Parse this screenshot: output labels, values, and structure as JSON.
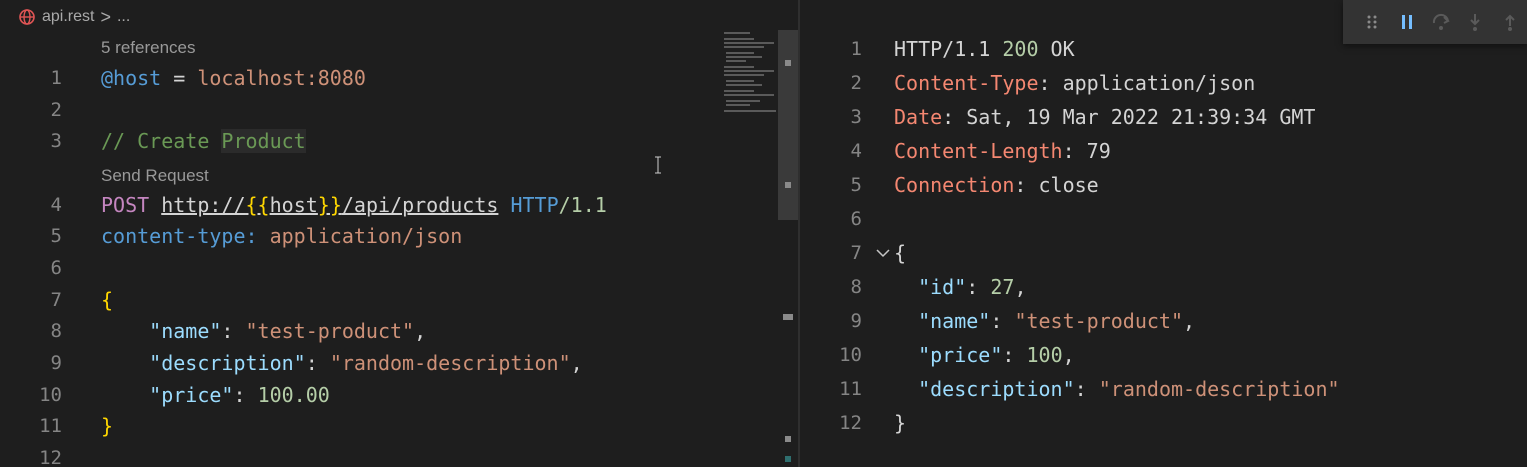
{
  "breadcrumb": {
    "file": "api.rest",
    "separator": ">",
    "more": "..."
  },
  "editor": {
    "references_label": "5 references",
    "send_request_label": "Send Request",
    "line_numbers": [
      "1",
      "2",
      "3",
      "4",
      "5",
      "6",
      "7",
      "8",
      "9",
      "10",
      "11",
      "12"
    ],
    "line1": {
      "var": "@host",
      "eq": " = ",
      "value": "localhost:8080"
    },
    "line3": {
      "comment": "// Create ",
      "comment_word": "Product"
    },
    "line4": {
      "method": "POST",
      "space": " ",
      "url_prefix": "http://",
      "brace_open": "{{",
      "url_var": "host",
      "brace_close": "}}",
      "url_path": "/api/products",
      "proto": "HTTP",
      "version": "/1.1"
    },
    "line5": {
      "header": "content-type:",
      "value": " application/json"
    },
    "line7": "{",
    "line8": {
      "indent": "    ",
      "key": "\"name\"",
      "colon": ": ",
      "value": "\"test-product\"",
      "comma": ","
    },
    "line9": {
      "indent": "    ",
      "key": "\"description\"",
      "colon": ": ",
      "value": "\"random-description\"",
      "comma": ","
    },
    "line10": {
      "indent": "    ",
      "key": "\"price\"",
      "colon": ": ",
      "value": "100.00"
    },
    "line11": "}"
  },
  "response": {
    "line_numbers": [
      "1",
      "2",
      "3",
      "4",
      "5",
      "6",
      "7",
      "8",
      "9",
      "10",
      "11",
      "12"
    ],
    "status": {
      "proto": "HTTP/1.1 ",
      "code": "200",
      "text": " OK"
    },
    "headers": [
      {
        "name": "Content-Type",
        "value": ": application/json"
      },
      {
        "name": "Date",
        "value": ": Sat, 19 Mar 2022 21:39:34 GMT"
      },
      {
        "name": "Content-Length",
        "value": ": 79"
      },
      {
        "name": "Connection",
        "value": ": close"
      }
    ],
    "body_open": "{",
    "body": [
      {
        "indent": "  ",
        "key": "\"id\"",
        "colon": ": ",
        "value": "27",
        "comma": ",",
        "type": "num"
      },
      {
        "indent": "  ",
        "key": "\"name\"",
        "colon": ": ",
        "value": "\"test-product\"",
        "comma": ",",
        "type": "str"
      },
      {
        "indent": "  ",
        "key": "\"price\"",
        "colon": ": ",
        "value": "100",
        "comma": ",",
        "type": "num"
      },
      {
        "indent": "  ",
        "key": "\"description\"",
        "colon": ": ",
        "value": "\"random-description\"",
        "comma": "",
        "type": "str"
      }
    ],
    "body_close": "}"
  },
  "debug_toolbar": {
    "icons": [
      "drag-handle-icon",
      "pause-icon",
      "step-over-icon",
      "step-into-icon",
      "step-out-icon"
    ]
  },
  "colors": {
    "background": "#1e1e1e",
    "keyword": "#569cd6",
    "property": "#9cdcfe",
    "string": "#ce9178",
    "number": "#b5cea8",
    "comment": "#6a9955",
    "header_name": "#f48771"
  }
}
